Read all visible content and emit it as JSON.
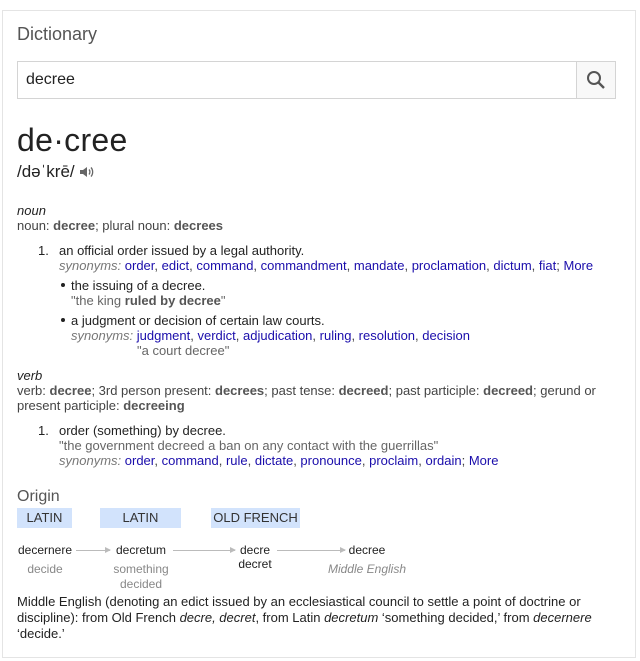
{
  "header": {
    "title": "Dictionary"
  },
  "search": {
    "value": "decree"
  },
  "entry": {
    "word": "de·cree",
    "phonetic": "/dəˈkrē/"
  },
  "noun": {
    "pos": "noun",
    "forms_pre": "noun: ",
    "forms_w1": "decree",
    "forms_mid": "; plural noun: ",
    "forms_w2": "decrees",
    "sense1": {
      "num": "1.",
      "def": "an official order issued by a legal authority.",
      "syn_label": "synonyms:",
      "synonyms": [
        "order",
        "edict",
        "command",
        "commandment",
        "mandate",
        "proclamation",
        "dictum",
        "fiat"
      ],
      "more": "More"
    },
    "sub1": {
      "def": "the issuing of a decree.",
      "ex_pre": "\"the king ",
      "ex_b": "ruled by decree",
      "ex_post": "\""
    },
    "sub2": {
      "def": "a judgment or decision of certain law courts.",
      "syn_label": "synonyms:",
      "synonyms": [
        "judgment",
        "verdict",
        "adjudication",
        "ruling",
        "resolution",
        "decision"
      ],
      "example": "\"a court decree\""
    }
  },
  "verb": {
    "pos": "verb",
    "f1": "verb: ",
    "w1": "decree",
    "f2": "; 3rd person present: ",
    "w2": "decrees",
    "f3": "; past tense: ",
    "w3": "decreed",
    "f4": "; past participle: ",
    "w4": "decreed",
    "f5": "; gerund or",
    "f6": "present participle: ",
    "w6": "decreeing",
    "sense1": {
      "num": "1.",
      "def": "order (something) by decree.",
      "example": "\"the government decreed a ban on any contact with the guerrillas\"",
      "syn_label": "synonyms:",
      "synonyms": [
        "order",
        "command",
        "rule",
        "dictate",
        "pronounce",
        "proclaim",
        "ordain"
      ],
      "more": "More"
    }
  },
  "origin": {
    "heading": "Origin",
    "langs": [
      "LATIN",
      "LATIN",
      "OLD FRENCH"
    ],
    "words": [
      "decernere",
      "decretum",
      "decre\ndecret",
      "decree"
    ],
    "glosses": [
      "decide",
      "something\ndecided",
      "",
      "Middle English"
    ],
    "para": {
      "p1": "Middle English (denoting an edict issued by an ecclesiastical council to settle a point of doctrine or discipline): from Old French ",
      "i1": "decre, decret",
      "p2": ", from Latin ",
      "i2": "decretum",
      "p3": " ‘something decided,’ from ",
      "i3": "decernere",
      "p4": " ‘decide.’"
    }
  },
  "colors": {
    "link": "#1a0dab",
    "etym_bg": "#d2e3fc"
  }
}
